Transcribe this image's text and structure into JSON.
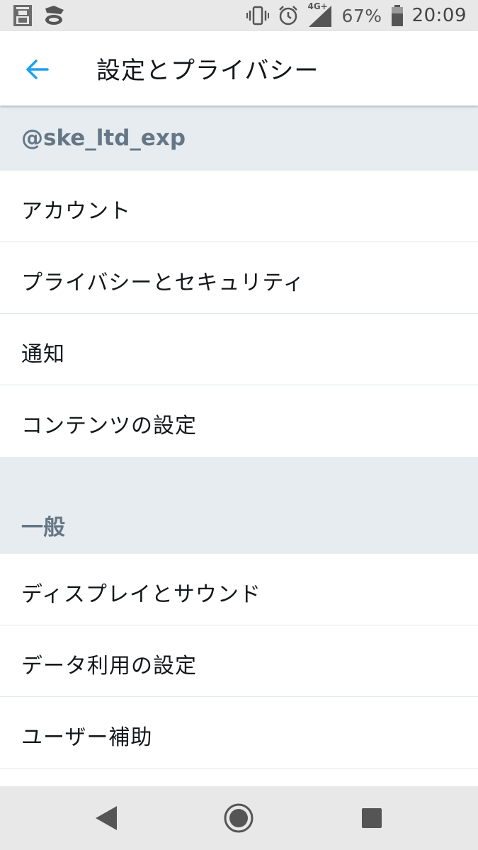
{
  "status_bar": {
    "left_icons": [
      "app-notification-icon",
      "mail-notification-icon"
    ],
    "right_icons": [
      "vibrate-icon",
      "alarm-icon",
      "signal-icon",
      "battery-icon"
    ],
    "network": "4G+",
    "battery": "67%",
    "time": "20:09"
  },
  "toolbar": {
    "title": "設定とプライバシー",
    "back_icon": "arrow-left-icon",
    "accent_color": "#1da1f2"
  },
  "sections": [
    {
      "header": "@ske_ltd_exp",
      "items": [
        {
          "label": "アカウント"
        },
        {
          "label": "プライバシーとセキュリティ"
        },
        {
          "label": "通知"
        },
        {
          "label": "コンテンツの設定"
        }
      ]
    },
    {
      "header": "一般",
      "items": [
        {
          "label": "ディスプレイとサウンド"
        },
        {
          "label": "データ利用の設定"
        },
        {
          "label": "ユーザー補助"
        }
      ]
    }
  ],
  "nav_bar": {
    "icons": [
      "back-triangle-icon",
      "home-circle-icon",
      "recents-square-icon"
    ]
  },
  "colors": {
    "section_header_bg": "#e6ecf0",
    "section_header_text": "#657786",
    "divider": "#e1e8ed",
    "text": "#14171a"
  }
}
